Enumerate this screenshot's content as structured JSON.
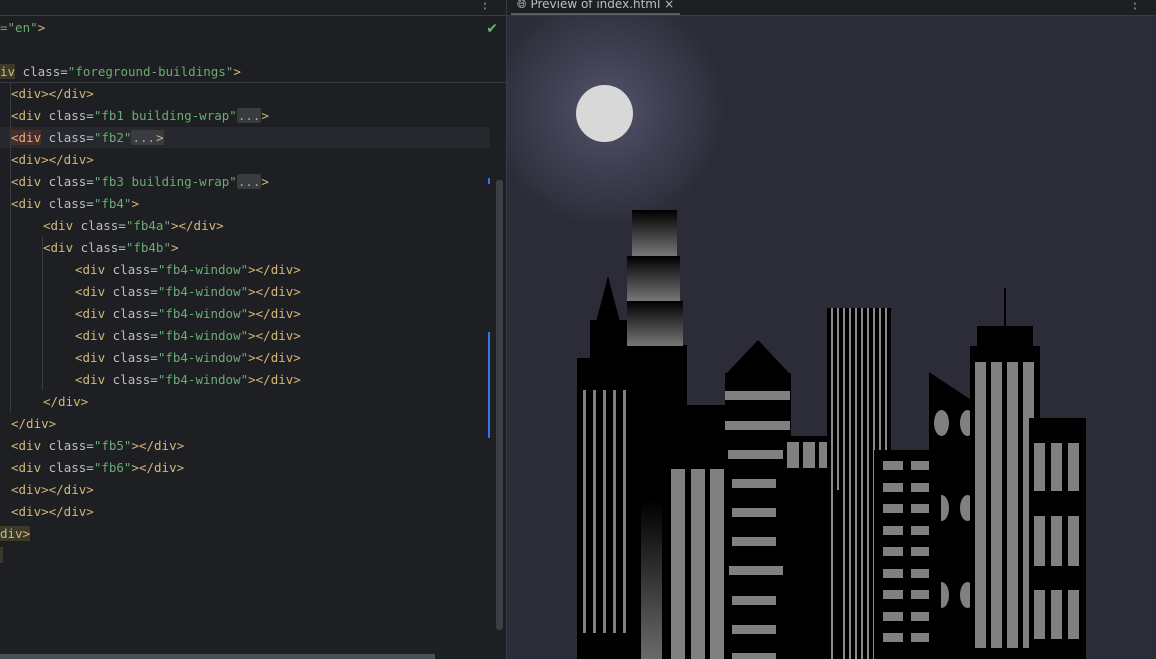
{
  "editor": {
    "sticky_lines": [
      {
        "pre": "",
        "t1": "",
        "t2": "=\"en\">"
      },
      {
        "pre": "",
        "t1": "",
        "t2": ""
      },
      {
        "pre": "",
        "t1": "iv",
        "t2": " class=\"foreground-buildings\">"
      }
    ],
    "lines": [
      "<div></div>",
      "<div class=\"fb1 building-wrap\"...>",
      "<div class=\"fb2\"...>",
      "<div></div>",
      "<div class=\"fb3 building-wrap\"...>",
      "<div class=\"fb4\">",
      "<div class=\"fb4a\"></div>",
      "<div class=\"fb4b\">",
      "<div class=\"fb4-window\"></div>",
      "<div class=\"fb4-window\"></div>",
      "<div class=\"fb4-window\"></div>",
      "<div class=\"fb4-window\"></div>",
      "<div class=\"fb4-window\"></div>",
      "<div class=\"fb4-window\"></div>",
      "</div>",
      "</div>",
      "<div class=\"fb5\"></div>",
      "<div class=\"fb6\"></div>",
      "<div></div>",
      "<div></div>",
      "div>"
    ],
    "status_icon": "check-icon",
    "menu_icon": "more-vertical-icon"
  },
  "preview": {
    "tab_label": "Preview of index.html",
    "tab_icon": "globe-icon",
    "menu_icon": "more-vertical-icon",
    "colors": {
      "sky": "#2c2c38",
      "moon": "#d8d8d8",
      "building": "#000000",
      "window": "#808080"
    }
  }
}
